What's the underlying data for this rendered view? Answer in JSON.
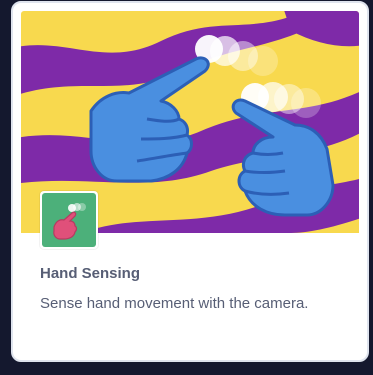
{
  "extension": {
    "name": "Hand Sensing",
    "description": "Sense hand movement with the camera.",
    "icon": "hand-sensing-icon",
    "banner": "hand-sensing-banner"
  },
  "colors": {
    "banner_yellow": "#f8d94e",
    "banner_purple": "#7e2aa8",
    "hand_blue": "#4a8fe0",
    "hand_outline": "#2c5fb6",
    "icon_bg": "#4cb07a",
    "icon_hand": "#e0507a",
    "text": "#575e75"
  }
}
